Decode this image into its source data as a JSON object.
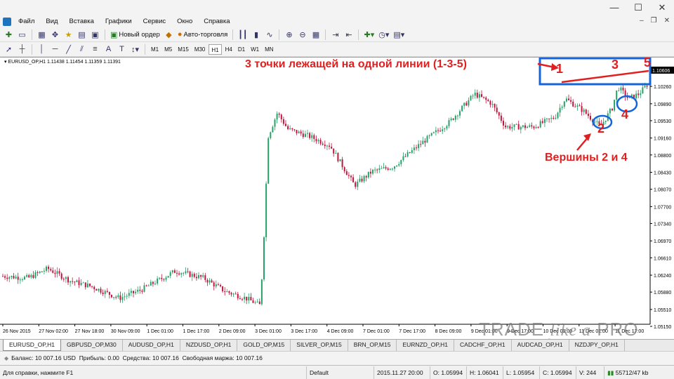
{
  "window": {
    "minimize": "—",
    "maximize": "☐",
    "close": "✕"
  },
  "menu": {
    "items": [
      "Файл",
      "Вид",
      "Вставка",
      "Графики",
      "Сервис",
      "Окно",
      "Справка"
    ],
    "right_minimize": "–",
    "right_restore": "❐",
    "right_close": "✕"
  },
  "toolbar": {
    "new_order_label": "Новый ордер",
    "autotrading_label": "Авто-торговля",
    "timeframes": [
      "M1",
      "M5",
      "M15",
      "M30",
      "H1",
      "H4",
      "D1",
      "W1",
      "MN"
    ],
    "active_timeframe": "H1"
  },
  "chart": {
    "symbol_info": "EURUSD_OP,H1  1.11438 1.11454 1.11359 1.11391",
    "current_price_label": "1.10606",
    "price_ticks": [
      "1.10620",
      "1.10260",
      "1.09890",
      "1.09530",
      "1.09160",
      "1.08800",
      "1.08430",
      "1.08070",
      "1.07700",
      "1.07340",
      "1.06970",
      "1.06610",
      "1.06240",
      "1.05880",
      "1.05510",
      "1.05150"
    ],
    "time_ticks": [
      "26 Nov 2015",
      "27 Nov 02:00",
      "27 Nov 18:00",
      "30 Nov 09:00",
      "1 Dec 01:00",
      "1 Dec 17:00",
      "2 Dec 09:00",
      "3 Dec 01:00",
      "3 Dec 17:00",
      "4 Dec 09:00",
      "7 Dec 01:00",
      "7 Dec 17:00",
      "8 Dec 09:00",
      "9 Dec 01:00",
      "9 Dec 17:00",
      "10 Dec 09:00",
      "11 Dec 01:00",
      "11 Dec 17:00"
    ],
    "up_color": "#26a269",
    "down_color": "#c0143c"
  },
  "annotations": {
    "title": "3 точки лежащей на одной линии (1-3-5)",
    "peaks": "Вершины 2 и 4",
    "points": [
      "1",
      "2",
      "3",
      "4",
      "5"
    ],
    "color": "#e02020",
    "box_color": "#1565d8"
  },
  "tabs": [
    "EURUSD_OP,H1",
    "GBPUSD_OP,M30",
    "AUDUSD_OP,H1",
    "NZDUSD_OP,H1",
    "GOLD_OP,M15",
    "SILVER_OP,M15",
    "BRN_OP,M15",
    "EURNZD_OP,H1",
    "CADCHF_OP,H1",
    "AUDCAD_OP,H1",
    "NZDJPY_OP,H1"
  ],
  "active_tab": "EURUSD_OP,H1",
  "balance": {
    "balance": "Баланс: 10 007.16 USD",
    "profit": "Прибыль: 0.00",
    "equity": "Средства: 10 007.16",
    "free_margin": "Свободная маржа: 10 007.16"
  },
  "statusbar": {
    "help": "Для справки, нажмите F1",
    "profile": "Default",
    "datetime": "2015.11.27 20:00",
    "open": "O: 1.05994",
    "high": "H: 1.06041",
    "low": "L: 1.05954",
    "close": "C: 1.05994",
    "volume": "V: 244",
    "traffic": "55712/47 kb"
  },
  "watermark": {
    "brand_1": "TRADE ",
    "brand_2": "like a",
    "brand_3": " PRO",
    "url": "www.tradelikeapro.ru"
  }
}
